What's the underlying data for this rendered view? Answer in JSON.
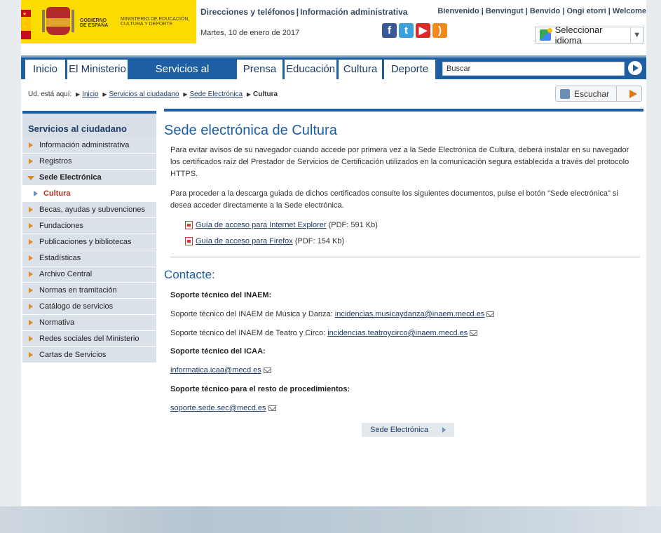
{
  "header": {
    "gov_text": "GOBIERNO DE ESPAÑA",
    "ministry_text": "MINISTERIO DE EDUCACIÓN, CULTURA Y DEPORTE",
    "top_link_1": "Direcciones y teléfonos",
    "top_link_2": "Información administrativa",
    "lang_links": [
      "Bienvenido",
      "Benvingut",
      "Benvido",
      "Ongi etorri",
      "Welcome"
    ],
    "date": "Martes, 10 de enero de 2017",
    "language_select": "Seleccionar idioma",
    "social": [
      "facebook-icon",
      "twitter-icon",
      "youtube-icon",
      "rss-icon"
    ]
  },
  "nav": {
    "items": [
      "Inicio",
      "El Ministerio",
      "Servicios al ciudadano",
      "Prensa",
      "Educación",
      "Cultura",
      "Deporte"
    ],
    "active": "Servicios al ciudadano",
    "search_placeholder": "Buscar"
  },
  "breadcrumb": {
    "prefix": "Ud. está aquí:",
    "items": [
      "Inicio",
      "Servicios al ciudadano",
      "Sede Electrónica"
    ],
    "current": "Cultura"
  },
  "listen_label": "Escuchar",
  "sidebar": {
    "title": "Servicios al ciudadano",
    "items": [
      "Información administrativa",
      "Registros",
      "Sede Electrónica",
      "Cultura",
      "Becas, ayudas y subvenciones",
      "Fundaciones",
      "Publicaciones y bibliotecas",
      "Estadísticas",
      "Archivo Central",
      "Normas en tramitación",
      "Catálogo de servicios",
      "Normativa",
      "Redes sociales del Ministerio",
      "Cartas de Servicios"
    ]
  },
  "main": {
    "title": "Sede electrónica de Cultura",
    "para1": "Para evitar avisos de su navegador cuando accede por primera vez a la Sede Electrónica de Cultura, deberá instalar en su navegador los certificados raíz del Prestador de Servicios de Certificación utilizados en la comunicación segura establecida a través del protocolo HTTPS.",
    "para2": "Para proceder a la descarga guiada de dichos certificados consulte los siguientes documentos, pulse el botón \"Sede electrónica\" si desea acceder directamente a la Sede electrónica.",
    "doc1_link": "Guía de acceso para Internet Explorer",
    "doc1_size": "(PDF: 591 Kb)",
    "doc2_link": "Guía de acceso para Firefox",
    "doc2_size": "(PDF: 154 Kb)",
    "contact_title": "Contacte:",
    "label_inaem": "Soporte técnico del INAEM:",
    "inaem1_text": "Soporte técnico del INAEM de Música y Danza:",
    "inaem1_email": "incidencias.musicaydanza@inaem.mecd.es",
    "inaem2_text": "Soporte técnico del INAEM de Teatro y Circo:",
    "inaem2_email": "incidencias.teatroycirco@inaem.mecd.es",
    "label_icaa": "Soporte técnico del ICAA:",
    "icaa_email": "informatica.icaa@mecd.es",
    "label_rest": "Soporte técnico para el resto de procedimientos:",
    "rest_email": "soporte.sede.sec@mecd.es",
    "sede_button": "Sede Electrónica"
  }
}
